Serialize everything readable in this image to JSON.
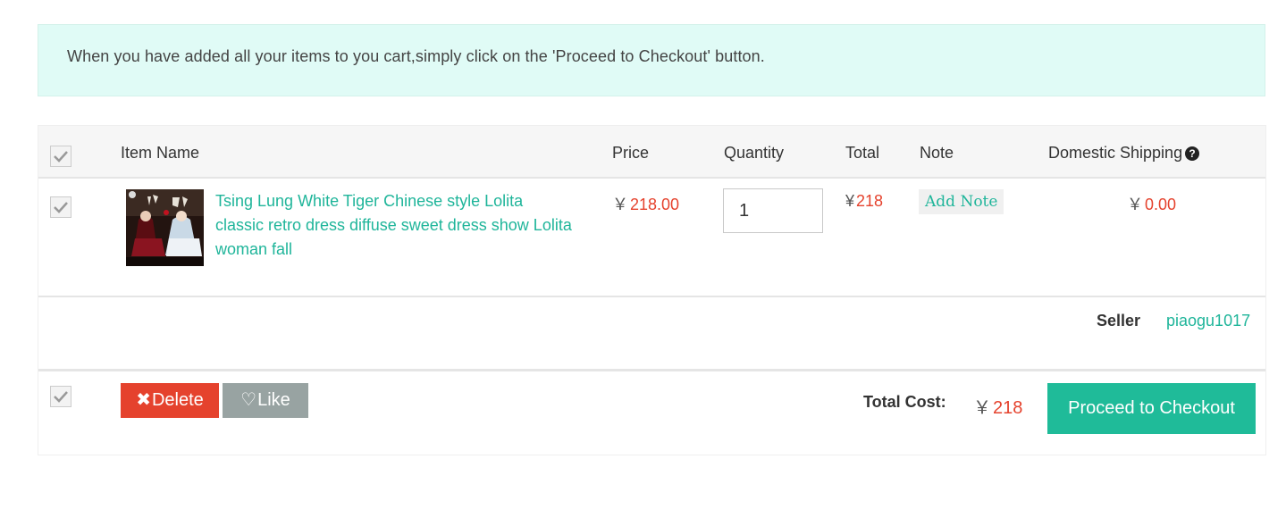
{
  "notice": {
    "text": "When you have added all your items to you cart,simply click on the 'Proceed to Checkout' button."
  },
  "table": {
    "headers": {
      "item_name": "Item Name",
      "price": "Price",
      "quantity": "Quantity",
      "total": "Total",
      "note": "Note",
      "domestic_shipping": "Domestic Shipping"
    },
    "help_icon": "question-circle-icon"
  },
  "item": {
    "title": "Tsing Lung White Tiger Chinese style Lolita classic retro dress diffuse sweet dress show Lolita woman fall",
    "price_symbol": "￥",
    "price": "218.00",
    "quantity": "1",
    "total_symbol": "¥",
    "total": "218",
    "add_note_label": "Add Note",
    "shipping_symbol": "￥",
    "shipping": "0.00",
    "image_icon": "product-thumbnail"
  },
  "seller": {
    "label": "Seller",
    "name": "piaogu1017"
  },
  "footer": {
    "delete_label": "Delete",
    "like_label": "Like",
    "total_cost_label": "Total Cost:",
    "total_cost_symbol": "￥",
    "total_cost": "218",
    "checkout_label": "Proceed to Checkout"
  },
  "colors": {
    "accent_green": "#1fb59a",
    "price_red": "#e5422d",
    "notice_bg": "#e0fbf6",
    "like_gray": "#98a3a2"
  }
}
